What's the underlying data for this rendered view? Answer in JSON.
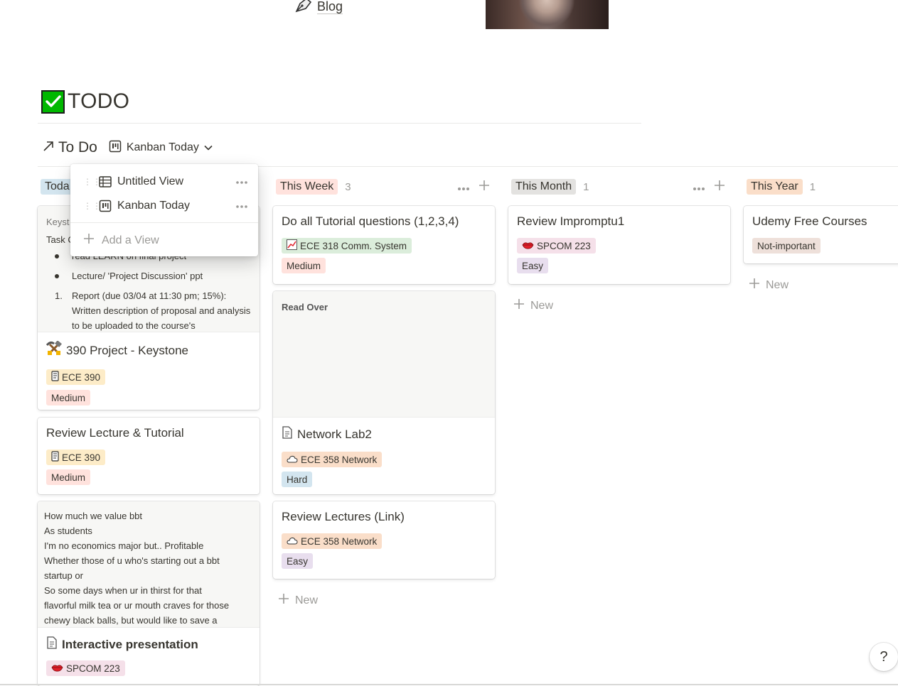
{
  "top": {
    "blog_label": "Blog"
  },
  "page": {
    "title": "TODO"
  },
  "database": {
    "link_label": "To Do",
    "current_view": "Kanban Today"
  },
  "dropdown": {
    "views": [
      {
        "label": "Untitled View",
        "icon": "table-icon"
      },
      {
        "label": "Kanban Today",
        "icon": "board-icon"
      }
    ],
    "add_label": "Add a View"
  },
  "colors": {
    "today_tag": "#d3e5ef",
    "week_tag": "#ffe2dd",
    "month_tag": "#e3e2e0",
    "year_tag": "#fadec9",
    "ece390": "#fdecc8",
    "ece318": "#dbeddb",
    "spcom": "#f5e0e9",
    "ece358": "#fadec9",
    "medium": "#ffe2dd",
    "easy": "#e8deee",
    "hard": "#d3e5ef",
    "notimportant": "#eee0da"
  },
  "columns": {
    "today": {
      "label": "Toda",
      "card1": {
        "preview_lines": [
          "Keyst",
          "Task C"
        ],
        "bullets": [
          "read LEARN on final project",
          "Lecture/ 'Project Discussion' ppt"
        ],
        "numbered": {
          "n": "1.",
          "text": "Report (due 03/04 at 11:30 pm; 15%): Written description of proposal and analysis to be uploaded to the course's"
        },
        "title": "390 Project - Keystone",
        "course": "ECE 390",
        "difficulty": "Medium"
      },
      "card2": {
        "title": "Review Lecture & Tutorial",
        "course": "ECE 390",
        "difficulty": "Medium"
      },
      "card3": {
        "preview": [
          "How much we value bbt",
          "As students",
          "I'm no economics major but.. Profitable",
          "Whether those of u who's starting out a bbt",
          "startup or",
          "So some days when ur in thirst for that",
          "flavorful milk tea or ur mouth craves for those",
          "chewy black balls, but would like to save a"
        ],
        "title": "Interactive presentation",
        "course": "SPCOM 223"
      }
    },
    "week": {
      "label": "This Week",
      "count": "3",
      "card1": {
        "title": "Do all Tutorial questions (1,2,3,4)",
        "course": "ECE 318 Comm. System",
        "difficulty": "Medium"
      },
      "card2": {
        "preview": "Read Over",
        "title": "Network Lab2",
        "course": "ECE 358 Network",
        "difficulty": "Hard"
      },
      "card3": {
        "title": "Review Lectures (Link)",
        "course": "ECE 358 Network",
        "difficulty": "Easy"
      },
      "new_label": "New"
    },
    "month": {
      "label": "This Month",
      "count": "1",
      "card1": {
        "title": "Review Impromptu1",
        "course": "SPCOM 223",
        "difficulty": "Easy"
      },
      "new_label": "New"
    },
    "year": {
      "label": "This Year",
      "count": "1",
      "card1": {
        "title": "Udemy Free Courses",
        "tag": "Not-important"
      },
      "new_label": "New"
    }
  },
  "help": {
    "label": "?"
  }
}
